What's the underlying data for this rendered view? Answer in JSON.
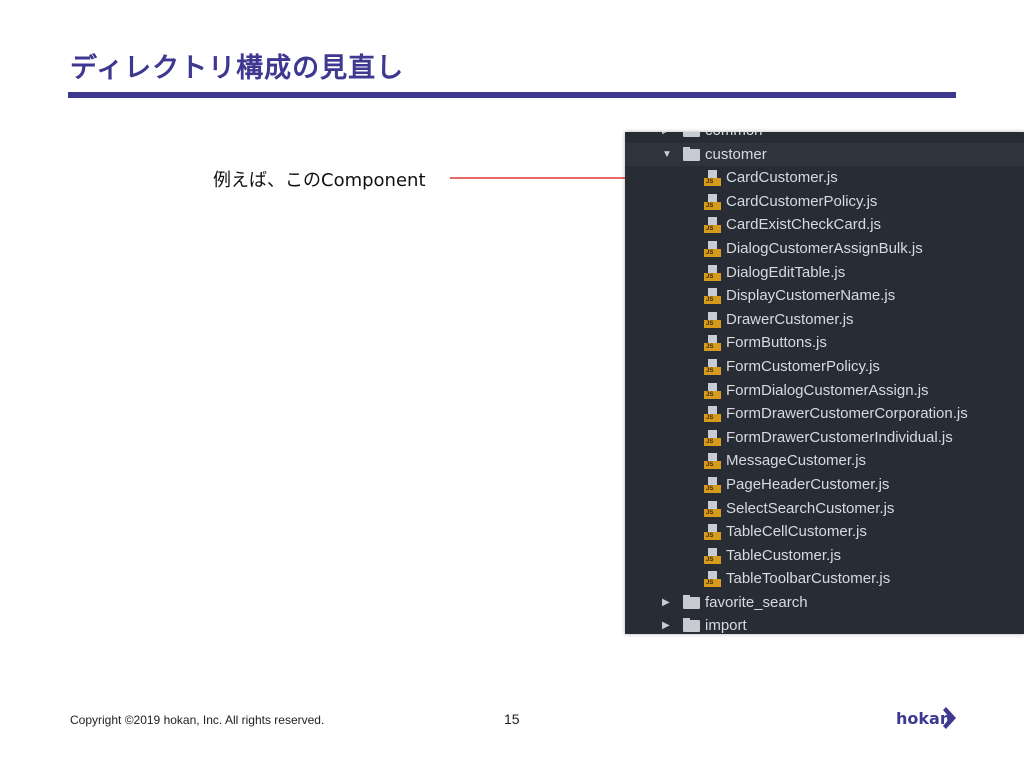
{
  "slide": {
    "title": "ディレクトリ構成の見直し",
    "caption": "例えば、このComponent",
    "footer": {
      "copyright": "Copyright ©2019 hokan, Inc. All rights reserved.",
      "page_number": "15",
      "logo": "hokan"
    },
    "colors": {
      "accent": "#3e3891",
      "arrow": "#e86a6a",
      "panel_bg": "#282c34",
      "js_badge": "#d69a1c"
    }
  },
  "tree": {
    "folders_before": [
      {
        "name": "common",
        "expanded": false,
        "icon": "folder-icon"
      }
    ],
    "open_folder": {
      "name": "customer",
      "expanded": true,
      "icon": "folder-icon"
    },
    "files": [
      "CardCustomer.js",
      "CardCustomerPolicy.js",
      "CardExistCheckCard.js",
      "DialogCustomerAssignBulk.js",
      "DialogEditTable.js",
      "DisplayCustomerName.js",
      "DrawerCustomer.js",
      "FormButtons.js",
      "FormCustomerPolicy.js",
      "FormDialogCustomerAssign.js",
      "FormDrawerCustomerCorporation.js",
      "FormDrawerCustomerIndividual.js",
      "MessageCustomer.js",
      "PageHeaderCustomer.js",
      "SelectSearchCustomer.js",
      "TableCellCustomer.js",
      "TableCustomer.js",
      "TableToolbarCustomer.js"
    ],
    "file_badge": "JS",
    "folders_after": [
      {
        "name": "favorite_search",
        "expanded": false
      },
      {
        "name": "import",
        "expanded": false
      }
    ]
  }
}
